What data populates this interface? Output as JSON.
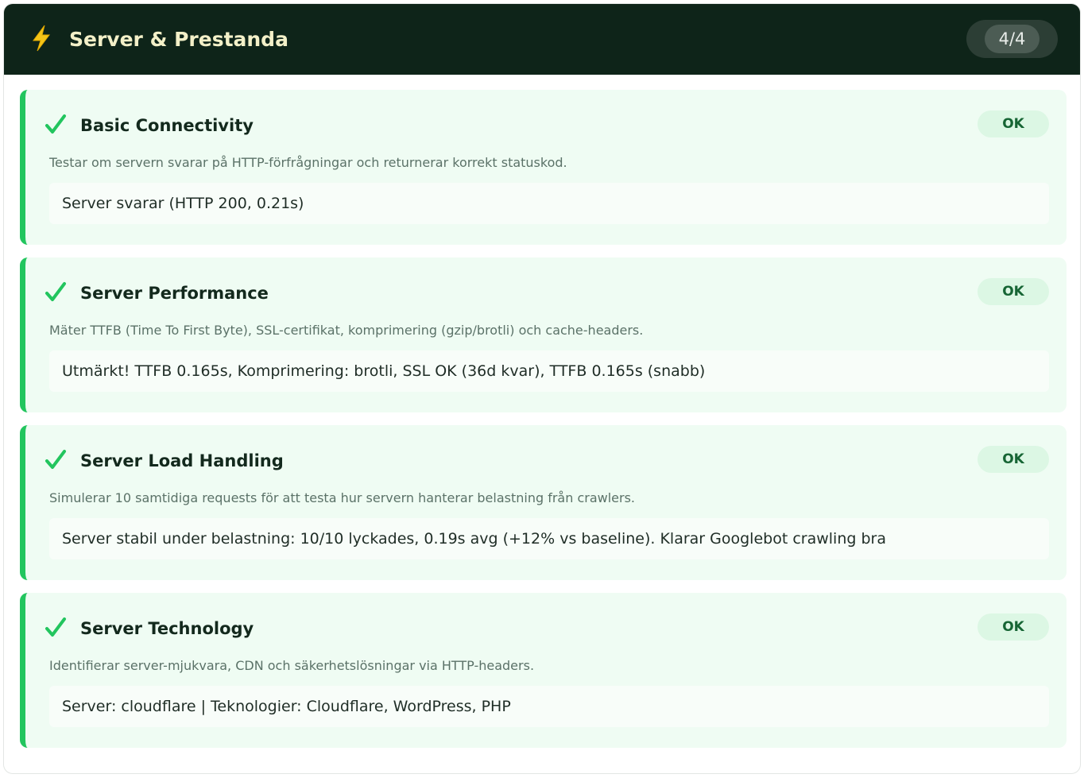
{
  "header": {
    "icon": "lightning-bolt-icon",
    "title": "Server & Prestanda",
    "count": "4/4"
  },
  "colors": {
    "header_bg": "#0e2419",
    "accent_green": "#22c55e",
    "item_bg": "#effcf3",
    "badge_bg": "#dcf7e4",
    "badge_text": "#166534"
  },
  "items": [
    {
      "icon": "check-icon",
      "title": "Basic Connectivity",
      "status": "OK",
      "description": "Testar om servern svarar på HTTP-förfrågningar och returnerar korrekt statuskod.",
      "result": "Server svarar (HTTP 200, 0.21s)"
    },
    {
      "icon": "check-icon",
      "title": "Server Performance",
      "status": "OK",
      "description": "Mäter TTFB (Time To First Byte), SSL-certifikat, komprimering (gzip/brotli) och cache-headers.",
      "result": "Utmärkt! TTFB 0.165s, Komprimering: brotli, SSL OK (36d kvar), TTFB 0.165s (snabb)"
    },
    {
      "icon": "check-icon",
      "title": "Server Load Handling",
      "status": "OK",
      "description": "Simulerar 10 samtidiga requests för att testa hur servern hanterar belastning från crawlers.",
      "result": "Server stabil under belastning: 10/10 lyckades, 0.19s avg (+12% vs baseline). Klarar Googlebot crawling bra"
    },
    {
      "icon": "check-icon",
      "title": "Server Technology",
      "status": "OK",
      "description": "Identifierar server-mjukvara, CDN och säkerhetslösningar via HTTP-headers.",
      "result": "Server: cloudflare | Teknologier: Cloudflare, WordPress, PHP"
    }
  ]
}
